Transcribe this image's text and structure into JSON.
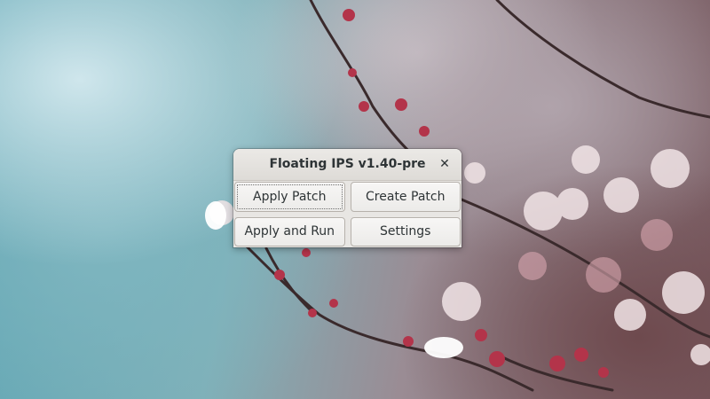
{
  "desktop": {
    "wallpaper": "cherry-blossom-branch"
  },
  "window": {
    "title": "Floating IPS v1.40-pre",
    "close_icon": "close-icon",
    "buttons": {
      "apply_patch": "Apply Patch",
      "create_patch": "Create Patch",
      "apply_and_run": "Apply and Run",
      "settings": "Settings"
    }
  },
  "colors": {
    "window_bg": "#e8e6e3",
    "text": "#2e3436",
    "button_border": "#b6b1ab"
  }
}
